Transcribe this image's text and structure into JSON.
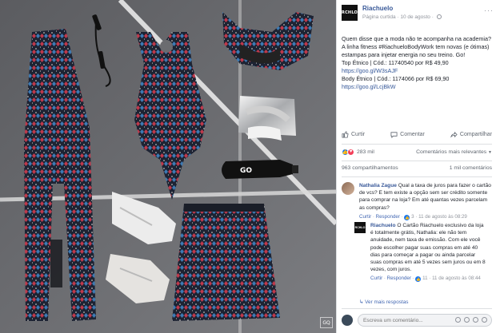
{
  "photo": {
    "watermark": "GQ"
  },
  "post": {
    "page_name": "Riachuelo",
    "page_avatar_text": "RCHLO",
    "meta": "Página curtida · 10 de agosto · ",
    "more": "···",
    "text_lines": [
      "Quem disse que a moda não te acompanha na academia? A linha fitness #RiachueloBodyWork tem novas (e ótimas) estampas para injetar energia no seu treino. Go!",
      "Top Étnico | Cód.: 11740540 por R$ 49,90",
      "Body Étnico | Cód.: 1174066 por R$ 69,90"
    ],
    "links": [
      "https://goo.gl/W3sAJF",
      "https://goo.gl/LcjBkW"
    ]
  },
  "actions": {
    "like": "Curtir",
    "comment": "Comentar",
    "share": "Compartilhar"
  },
  "reactions": {
    "count": "283 mil",
    "sort": "Comentários mais relevantes",
    "sort_caret": "▼"
  },
  "shares": {
    "shares": "963 compartilhamentos",
    "comments": "1 mil comentários"
  },
  "comments": [
    {
      "author": "Nathalia Zague",
      "text": "Qual a taxa de juros para fazer o cartão de vcs? E tem existe a opção sem ser crédito somente para comprar na loja? Em até quantas vezes parcelam as compras?",
      "like": "Curtir",
      "reply": "Responder",
      "like_count": "3",
      "date": "11 de agosto às 08:29"
    },
    {
      "author": "Riachuelo",
      "text": "O Cartão Riachuelo exclusivo da loja é totalmente grátis, Nathalia: ele não tem anuidade, nem taxa de emissão. Com ele você pode escolher pagar suas compras em até 40 dias para começar a pagar ou ainda parcelar suas compras em até 5 vezes sem juros ou em 8 vezes, com juros.",
      "like": "Curtir",
      "reply": "Responder",
      "like_count": "11",
      "date": "11 de agosto às 08:44"
    }
  ],
  "more_replies": "Ver mais respostas",
  "write": {
    "placeholder": "Escreva um comentário..."
  },
  "colors": {
    "link": "#365899",
    "brand": "#385898",
    "photo_bg": "#6b6c70"
  }
}
